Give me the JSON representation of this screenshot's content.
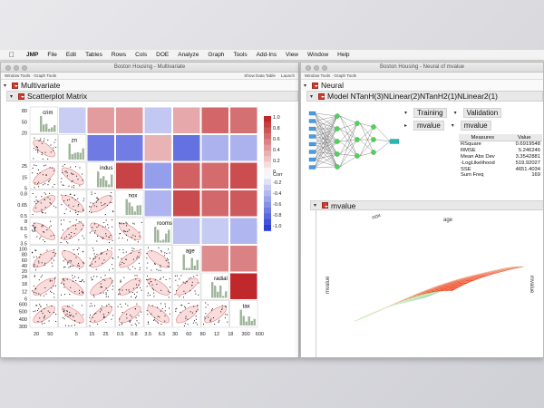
{
  "menubar": {
    "apple": "",
    "items": [
      "JMP",
      "File",
      "Edit",
      "Tables",
      "Rows",
      "Cols",
      "DOE",
      "Analyze",
      "Graph",
      "Tools",
      "Add-Ins",
      "View",
      "Window",
      "Help"
    ]
  },
  "left_window": {
    "title": "Boston Housing - Multivariate",
    "toolbar_left": "Window Tools · Graph Tools",
    "toolbar_right_1": "Show Data Table",
    "toolbar_right_2": "Launch",
    "outline_main": "Multivariate",
    "outline_sub": "Scatterplot Matrix",
    "matrix_labels": [
      "crim",
      "zn",
      "indus",
      "nox",
      "rooms",
      "age",
      "radial",
      "tax"
    ],
    "y_ticks": [
      [
        "80",
        "50",
        "20"
      ],
      [
        "",
        ""
      ],
      [
        "25",
        "15",
        "5"
      ],
      [
        "0.8",
        "0.65",
        "0.5"
      ],
      [
        "8",
        "6.5",
        "5",
        "3.5"
      ],
      [
        "100",
        "80",
        "60",
        "40",
        "20"
      ],
      [
        "24",
        "18",
        "12",
        "6"
      ],
      [
        "600",
        "500",
        "400",
        "300"
      ]
    ],
    "x_ticks": [
      "20",
      "50",
      "",
      "5",
      "15",
      "25",
      "0.5",
      "0.8",
      "3.5",
      "6.5",
      "30",
      "60",
      "80",
      "12",
      "18",
      "300",
      "600"
    ],
    "colorbar_ticks": [
      "1.0",
      "0.8",
      "0.6",
      "0.4",
      "0.2",
      "0",
      "-0.2",
      "-0.4",
      "-0.6",
      "-0.8",
      "-1.0"
    ],
    "colorbar_label": "Corr",
    "colors": {
      "pos": "#c0282b",
      "neg": "#2e3fd6",
      "accent": "#d23c2d"
    }
  },
  "right_window": {
    "title": "Boston Housing - Neural of mvalue",
    "toolbar_left": "Window Tools · Graph Tools",
    "outline_main": "Neural",
    "model_title": "Model NTanH(3)NLinear(2)NTanH2(1)NLinear2(1)",
    "training_label": "Training",
    "validation_label": "Validation",
    "mvalue_small": "mvalue",
    "mvalue_small2": "mvalue",
    "measures_header": [
      "Measures",
      "Value"
    ],
    "measures": [
      [
        "RSquare",
        "0.6919548"
      ],
      [
        "RMSE",
        "5.246246"
      ],
      [
        "Mean Abs Dev",
        "3.3542881"
      ],
      [
        "-LogLikelihood",
        "519.92027"
      ],
      [
        "SSE",
        "4651.4034"
      ],
      [
        "Sum Freq",
        "169"
      ]
    ],
    "surface_title": "mvalue",
    "surface_axes": {
      "x": "nox",
      "y": "age",
      "z": "mvalue"
    }
  }
}
